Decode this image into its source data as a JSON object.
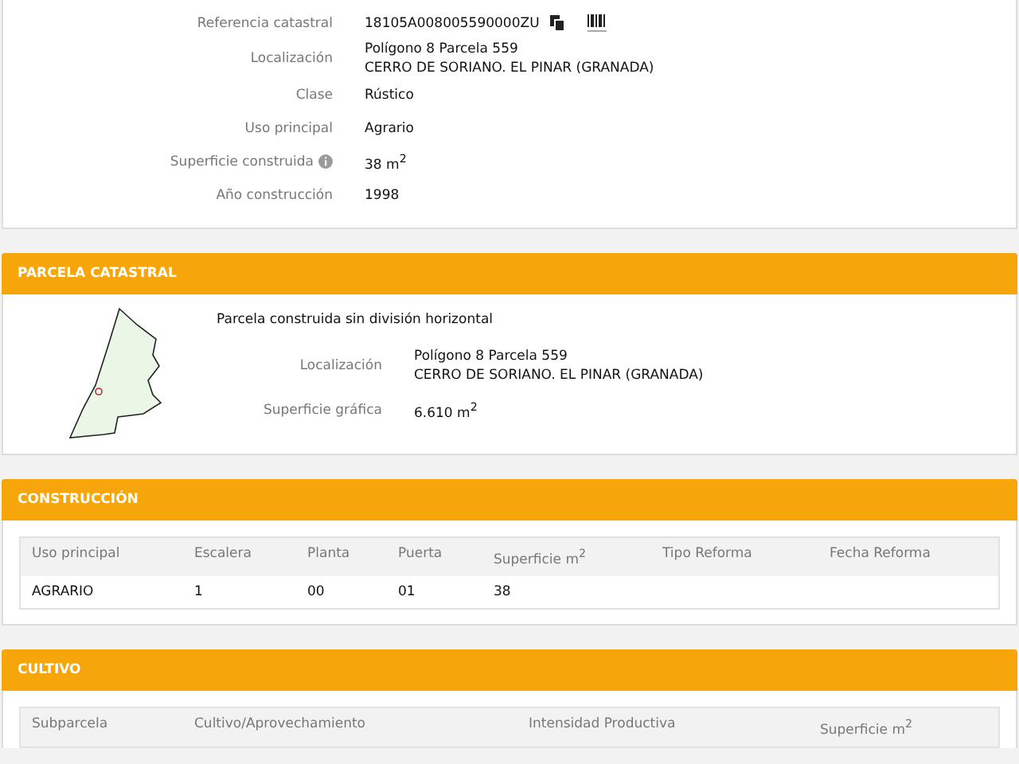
{
  "inmueble": {
    "rows": [
      {
        "label": "Referencia catastral",
        "lines": [
          "18105A008005590000ZU"
        ],
        "kind": "reference"
      },
      {
        "label": "Localización",
        "lines": [
          "Polígono 8 Parcela 559",
          "CERRO DE SORIANO. EL PINAR (GRANADA)"
        ],
        "kind": "plain"
      },
      {
        "label": "Clase",
        "lines": [
          "Rústico"
        ],
        "kind": "plain"
      },
      {
        "label": "Uso principal",
        "lines": [
          "Agrario"
        ],
        "kind": "plain"
      },
      {
        "label": "Superficie construida",
        "lines": [
          "38 m$^{2}$"
        ],
        "kind": "info"
      },
      {
        "label": "Año construcción",
        "lines": [
          "1998"
        ],
        "kind": "plain"
      }
    ]
  },
  "parcela": {
    "title": "PARCELA CATASTRAL",
    "description": "Parcela construida sin división horizontal",
    "rows": [
      {
        "label": "Localización",
        "lines": [
          "Polígono 8 Parcela 559",
          "CERRO DE SORIANO. EL PINAR (GRANADA)"
        ]
      },
      {
        "label": "Superficie gráfica",
        "lines": [
          "6.610 m$^{2}$"
        ]
      }
    ]
  },
  "construccion": {
    "title": "CONSTRUCCIÓN",
    "table": {
      "columns": [
        "Uso principal",
        "Escalera",
        "Planta",
        "Puerta",
        "Superficie m$^{2}$",
        "Tipo Reforma",
        "Fecha Reforma"
      ],
      "rows": [
        [
          "AGRARIO",
          "1",
          "00",
          "01",
          "38",
          "",
          ""
        ]
      ]
    }
  },
  "cultivo": {
    "title": "CULTIVO",
    "table": {
      "columns": [
        "Subparcela",
        "Cultivo/Aprovechamiento",
        "Intensidad Productiva",
        "Superficie m$^{2}$"
      ]
    }
  }
}
